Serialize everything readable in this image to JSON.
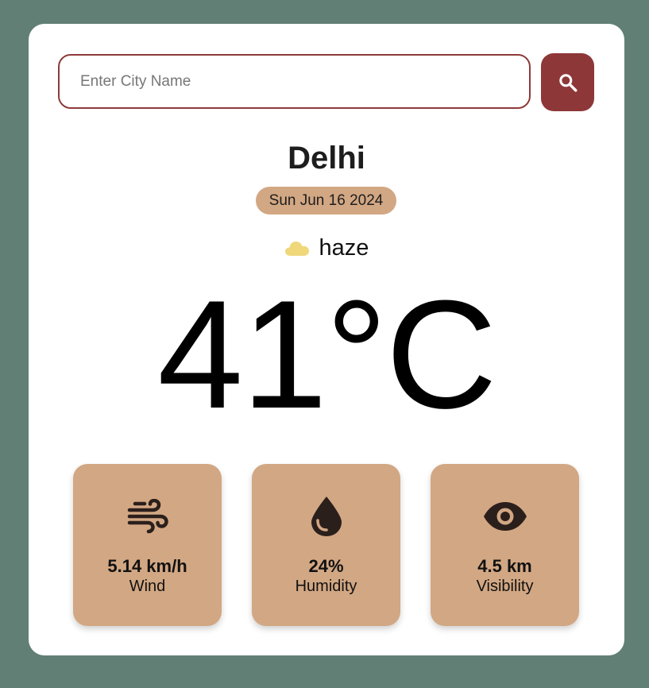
{
  "search": {
    "placeholder": "Enter City Name",
    "value": "",
    "button_icon": "search-icon"
  },
  "location": {
    "city": "Delhi",
    "date": "Sun Jun 16 2024"
  },
  "weather": {
    "condition": "haze",
    "condition_icon": "cloud-icon",
    "temperature": "41°C"
  },
  "stats": [
    {
      "icon": "wind-icon",
      "value": "5.14 km/h",
      "label": "Wind"
    },
    {
      "icon": "water-drop-icon",
      "value": "24%",
      "label": "Humidity"
    },
    {
      "icon": "eye-icon",
      "value": "4.5 km",
      "label": "Visibility"
    }
  ],
  "colors": {
    "background": "#627f75",
    "card": "#ffffff",
    "accent": "#8e3739",
    "tile": "#d2a783",
    "cloud": "#f0d77a",
    "icon": "#2b1f1c"
  }
}
